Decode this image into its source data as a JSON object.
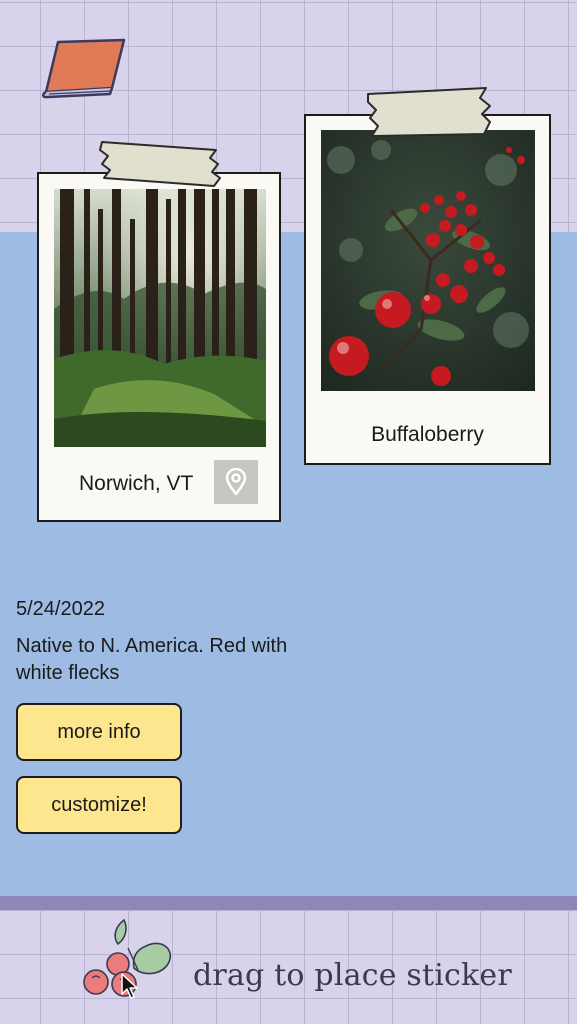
{
  "cards": [
    {
      "caption": "Norwich, VT",
      "photo_icon": "forest-photo",
      "action_icon": "location-pin-icon"
    },
    {
      "caption": "Buffaloberry",
      "photo_icon": "red-berries-photo"
    }
  ],
  "details": {
    "date": "5/24/2022",
    "description": "Native to N. America. Red with white flecks"
  },
  "buttons": {
    "more_info": "more info",
    "customize": "customize!"
  },
  "sticker_tray": {
    "hint": "drag to place sticker",
    "sticker_icon": "berry-sticker-icon"
  },
  "colors": {
    "grid_paper": "#d8d3ea",
    "board": "#9dbbe3",
    "button": "#fde68e",
    "book": "#e07a57"
  }
}
